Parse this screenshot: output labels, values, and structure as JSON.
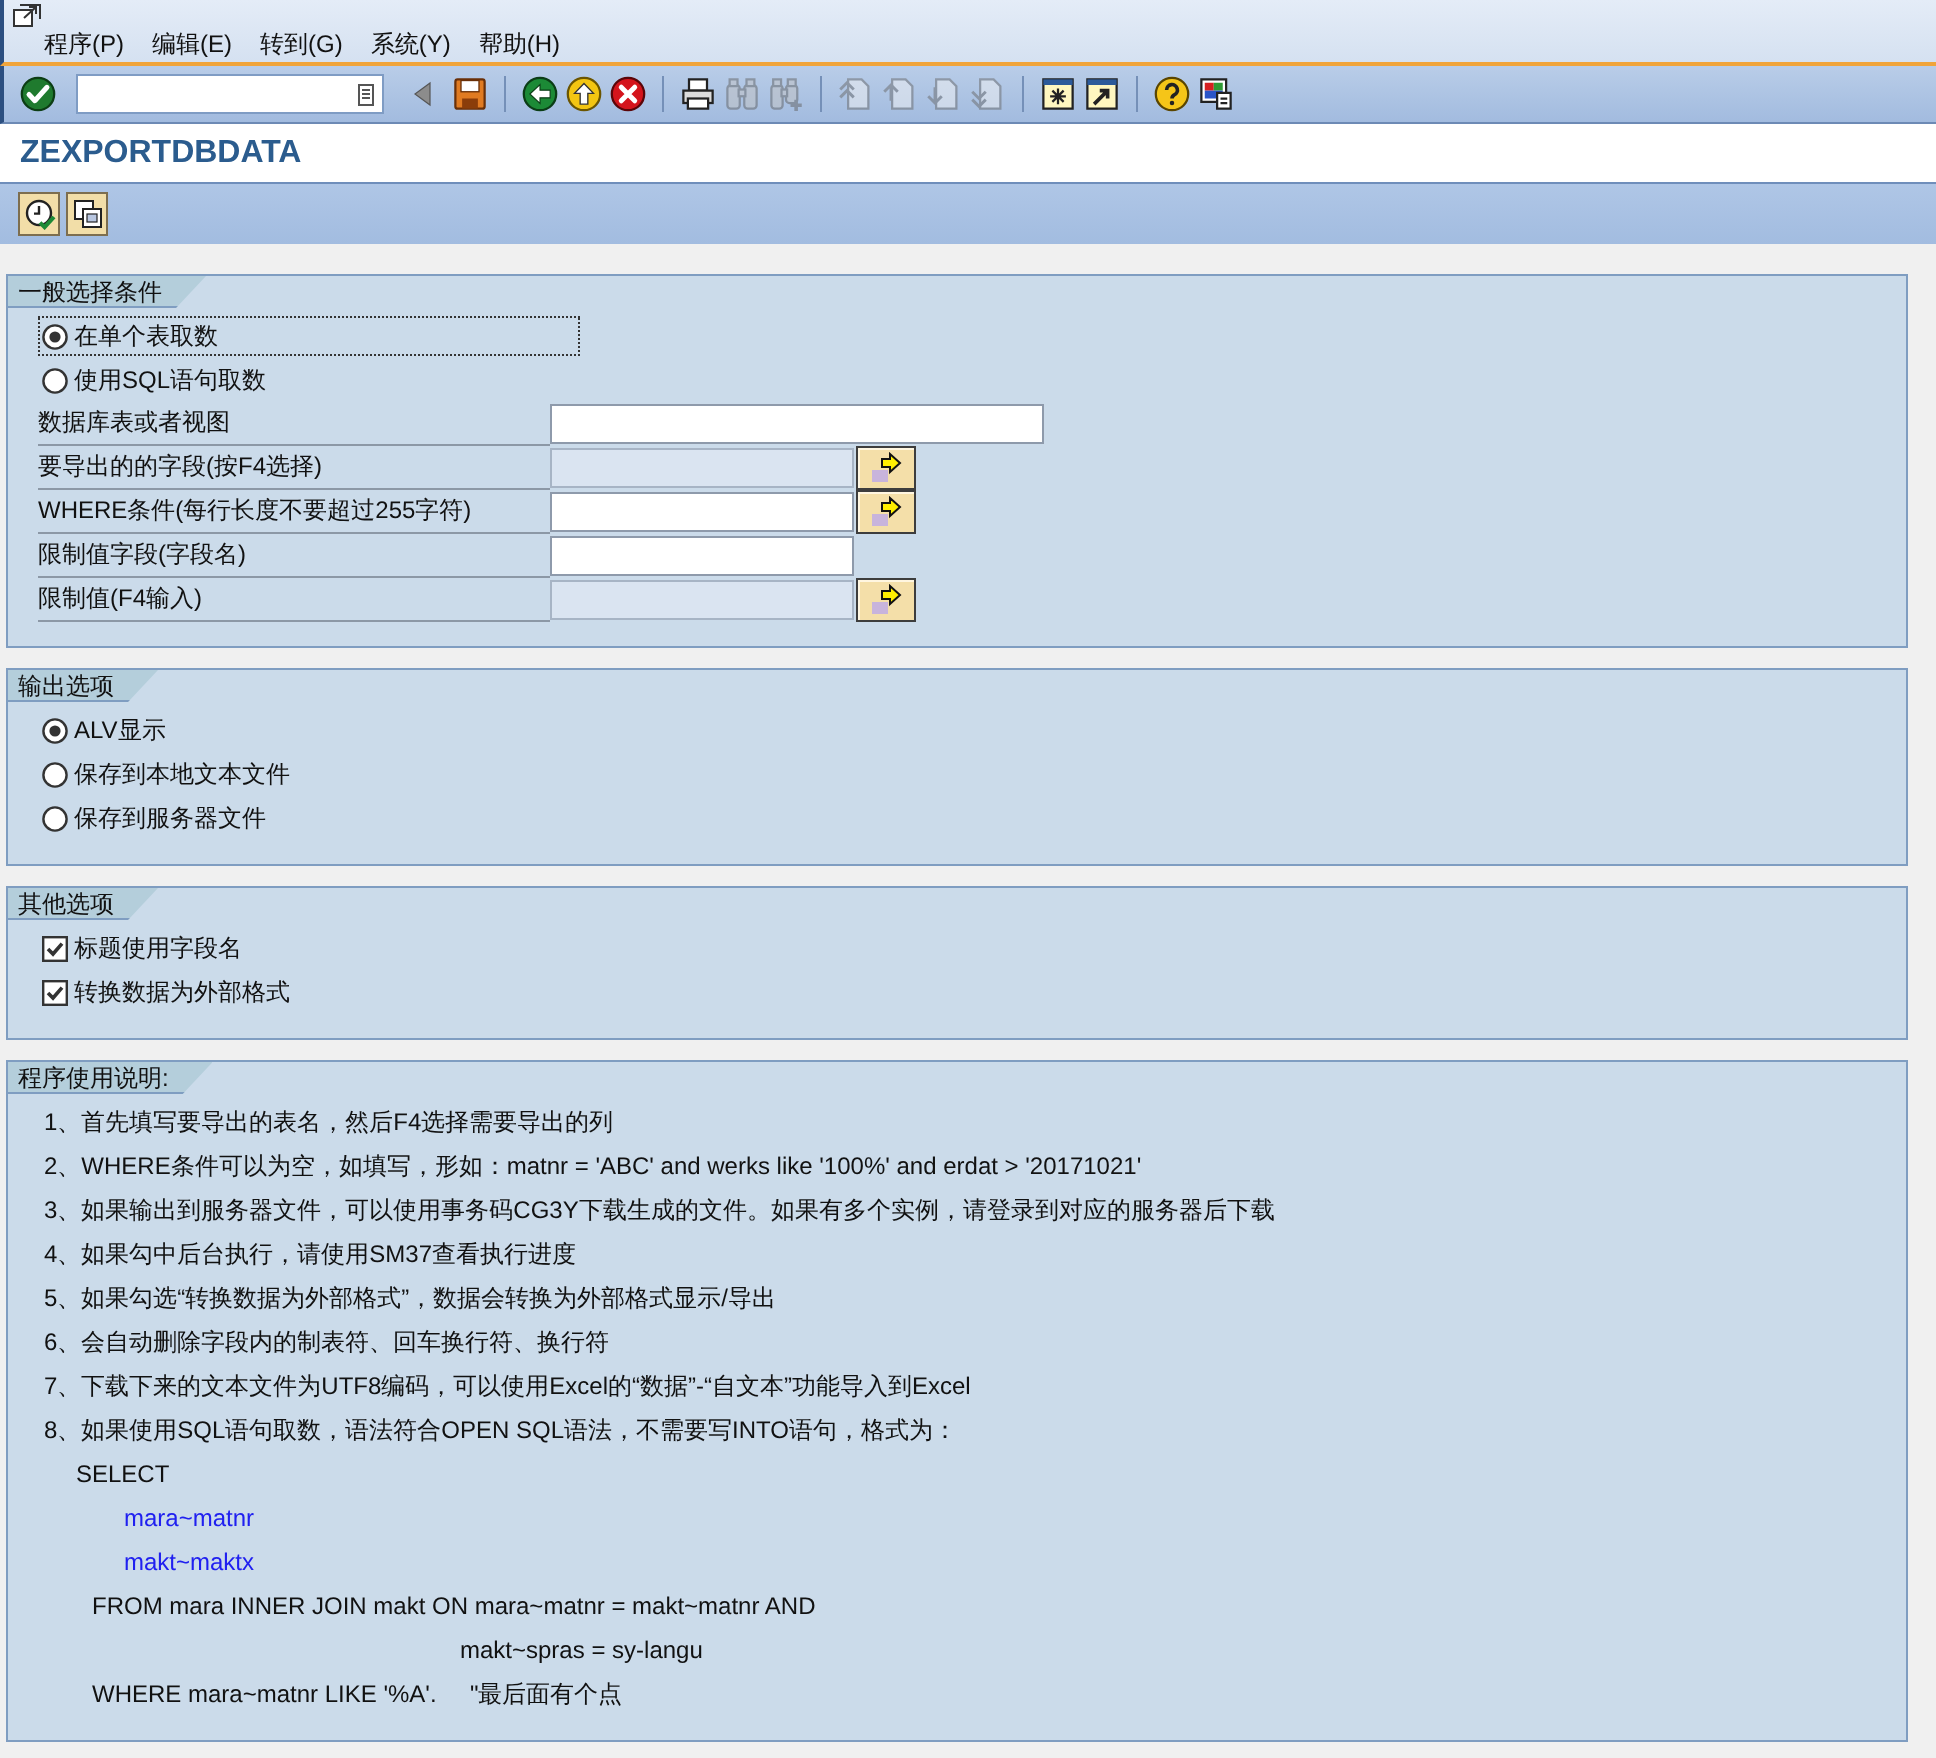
{
  "window": {
    "menu": [
      {
        "label": "程序(P)"
      },
      {
        "label": "编辑(E)"
      },
      {
        "label": "转到(G)"
      },
      {
        "label": "系统(Y)"
      },
      {
        "label": "帮助(H)"
      }
    ]
  },
  "toolbar": {
    "groups": [
      {
        "buttons": [
          {
            "kind": "enter",
            "disabled": false
          },
          {
            "kind": "command_field",
            "disabled": false
          },
          {
            "kind": "collapse",
            "disabled": false
          },
          {
            "kind": "save",
            "disabled": false
          }
        ]
      },
      {
        "buttons": [
          {
            "kind": "back",
            "disabled": false
          },
          {
            "kind": "exit",
            "disabled": false
          },
          {
            "kind": "cancel",
            "disabled": false
          }
        ]
      },
      {
        "buttons": [
          {
            "kind": "print",
            "disabled": false
          },
          {
            "kind": "find",
            "disabled": true
          },
          {
            "kind": "find_next",
            "disabled": true
          }
        ]
      },
      {
        "buttons": [
          {
            "kind": "first_page",
            "disabled": true
          },
          {
            "kind": "previous_page",
            "disabled": true
          },
          {
            "kind": "next_page",
            "disabled": true
          },
          {
            "kind": "last_page",
            "disabled": true
          }
        ]
      },
      {
        "buttons": [
          {
            "kind": "new_session",
            "disabled": false
          },
          {
            "kind": "shortcut",
            "disabled": false
          }
        ]
      },
      {
        "buttons": [
          {
            "kind": "help",
            "disabled": false
          },
          {
            "kind": "layout",
            "disabled": false
          }
        ]
      }
    ]
  },
  "title": "ZEXPORTDBDATA",
  "application_toolbar": {
    "buttons": [
      {
        "kind": "execute_background",
        "disabled": false
      },
      {
        "kind": "variants",
        "disabled": false
      }
    ]
  },
  "sections": [
    {
      "title": "一般选择条件",
      "items": [
        {
          "kind": "radio",
          "label": "在单个表取数",
          "selected": true,
          "focused": true
        },
        {
          "kind": "radio",
          "label": "使用SQL语句取数",
          "selected": false,
          "focused": false
        },
        {
          "kind": "field",
          "label": "数据库表或者视图",
          "disabled": false,
          "multiple_selection": false
        },
        {
          "kind": "field",
          "label": "要导出的的字段(按F4选择)",
          "disabled": true,
          "multiple_selection": true
        },
        {
          "kind": "field",
          "label": "WHERE条件(每行长度不要超过255字符)",
          "disabled": false,
          "multiple_selection": true
        },
        {
          "kind": "field",
          "label": "限制值字段(字段名)",
          "disabled": false,
          "multiple_selection": false
        },
        {
          "kind": "field",
          "label": "限制值(F4输入)",
          "disabled": true,
          "multiple_selection": true
        }
      ]
    },
    {
      "title": "输出选项",
      "items": [
        {
          "kind": "radio",
          "label": "ALV显示",
          "selected": true,
          "focused": false
        },
        {
          "kind": "radio",
          "label": "保存到本地文本文件",
          "selected": false,
          "focused": false
        },
        {
          "kind": "radio",
          "label": "保存到服务器文件",
          "selected": false,
          "focused": false
        }
      ]
    },
    {
      "title": "其他选项",
      "items": [
        {
          "kind": "checkbox",
          "label": "标题使用字段名",
          "checked": true
        },
        {
          "kind": "checkbox",
          "label": "转换数据为外部格式",
          "checked": true
        }
      ]
    },
    {
      "title": "程序使用说明:",
      "items": [
        {
          "kind": "text",
          "text": "1、首先填写要导出的表名，然后F4选择需要导出的列",
          "color": "#111111"
        },
        {
          "kind": "text",
          "text": "2、WHERE条件可以为空，如填写，形如：matnr = 'ABC' and werks like '100%' and erdat > '20171021'",
          "color": "#111111"
        },
        {
          "kind": "text",
          "text": "3、如果输出到服务器文件，可以使用事务码CG3Y下载生成的文件。如果有多个实例，请登录到对应的服务器后下载",
          "color": "#111111"
        },
        {
          "kind": "text",
          "text": "4、如果勾中后台执行，请使用SM37查看执行进度",
          "color": "#111111"
        },
        {
          "kind": "text",
          "text": "5、如果勾选“转换数据为外部格式”，数据会转换为外部格式显示/导出",
          "color": "#111111"
        },
        {
          "kind": "text",
          "text": "6、会自动删除字段内的制表符、回车换行符、换行符",
          "color": "#111111"
        },
        {
          "kind": "text",
          "text": "7、下载下来的文本文件为UTF8编码，可以使用Excel的“数据”-“自文本”功能导入到Excel",
          "color": "#111111"
        },
        {
          "kind": "text",
          "text": "8、如果使用SQL语句取数，语法符合OPEN SQL语法，不需要写INTO语句，格式为：",
          "color": "#111111"
        },
        {
          "kind": "text",
          "text": "SELECT",
          "color": "#111111"
        },
        {
          "kind": "text",
          "text": "mara~matnr",
          "color": "#2020f0"
        },
        {
          "kind": "text",
          "text": "makt~maktx",
          "color": "#2020f0"
        },
        {
          "kind": "text",
          "text": "FROM mara INNER JOIN makt ON mara~matnr = makt~matnr AND",
          "color": "#111111"
        },
        {
          "kind": "text",
          "text": "makt~spras = sy-langu",
          "color": "#111111"
        },
        {
          "kind": "text",
          "text": "WHERE mara~matnr LIKE '%A'.     \"最后面有个点",
          "color": "#111111"
        }
      ]
    }
  ]
}
